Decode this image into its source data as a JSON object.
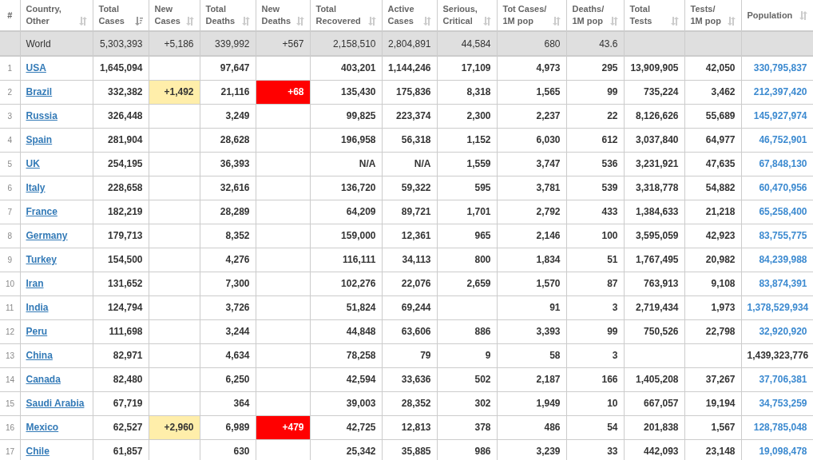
{
  "table": {
    "columns": [
      {
        "lines": [
          "#"
        ]
      },
      {
        "lines": [
          "Country,",
          "Other"
        ],
        "sorted": false
      },
      {
        "lines": [
          "Total",
          "Cases"
        ],
        "sorted": true
      },
      {
        "lines": [
          "New",
          "Cases"
        ],
        "sorted": false
      },
      {
        "lines": [
          "Total",
          "Deaths"
        ],
        "sorted": false
      },
      {
        "lines": [
          "New",
          "Deaths"
        ],
        "sorted": false
      },
      {
        "lines": [
          "Total",
          "Recovered"
        ],
        "sorted": false
      },
      {
        "lines": [
          "Active",
          "Cases"
        ],
        "sorted": false
      },
      {
        "lines": [
          "Serious,",
          "Critical"
        ],
        "sorted": false
      },
      {
        "lines": [
          "Tot Cases/",
          "1M pop"
        ],
        "sorted": false
      },
      {
        "lines": [
          "Deaths/",
          "1M pop"
        ],
        "sorted": false
      },
      {
        "lines": [
          "Total",
          "Tests"
        ],
        "sorted": false
      },
      {
        "lines": [
          "Tests/",
          "1M pop"
        ],
        "sorted": false
      },
      {
        "lines": [
          "Population"
        ],
        "sorted": false
      }
    ],
    "world": {
      "country": "World",
      "total_cases": "5,303,393",
      "new_cases": "+5,186",
      "total_deaths": "339,992",
      "new_deaths": "+567",
      "total_recovered": "2,158,510",
      "active_cases": "2,804,891",
      "serious_critical": "44,584",
      "tot_cases_per_1m": "680",
      "deaths_per_1m": "43.6"
    },
    "rows": [
      {
        "num": "1",
        "country": "USA",
        "total_cases": "1,645,094",
        "total_deaths": "97,647",
        "total_recovered": "403,201",
        "active_cases": "1,144,246",
        "serious_critical": "17,109",
        "tot_cases_per_1m": "4,973",
        "deaths_per_1m": "295",
        "total_tests": "13,909,905",
        "tests_per_1m": "42,050",
        "population": "330,795,837",
        "population_linked": true
      },
      {
        "num": "2",
        "country": "Brazil",
        "total_cases": "332,382",
        "new_cases": "+1,492",
        "total_deaths": "21,116",
        "new_deaths": "+68",
        "total_recovered": "135,430",
        "active_cases": "175,836",
        "serious_critical": "8,318",
        "tot_cases_per_1m": "1,565",
        "deaths_per_1m": "99",
        "total_tests": "735,224",
        "tests_per_1m": "3,462",
        "population": "212,397,420",
        "population_linked": true
      },
      {
        "num": "3",
        "country": "Russia",
        "total_cases": "326,448",
        "total_deaths": "3,249",
        "total_recovered": "99,825",
        "active_cases": "223,374",
        "serious_critical": "2,300",
        "tot_cases_per_1m": "2,237",
        "deaths_per_1m": "22",
        "total_tests": "8,126,626",
        "tests_per_1m": "55,689",
        "population": "145,927,974",
        "population_linked": true
      },
      {
        "num": "4",
        "country": "Spain",
        "total_cases": "281,904",
        "total_deaths": "28,628",
        "total_recovered": "196,958",
        "active_cases": "56,318",
        "serious_critical": "1,152",
        "tot_cases_per_1m": "6,030",
        "deaths_per_1m": "612",
        "total_tests": "3,037,840",
        "tests_per_1m": "64,977",
        "population": "46,752,901",
        "population_linked": true
      },
      {
        "num": "5",
        "country": "UK",
        "total_cases": "254,195",
        "total_deaths": "36,393",
        "total_recovered": "N/A",
        "active_cases": "N/A",
        "serious_critical": "1,559",
        "tot_cases_per_1m": "3,747",
        "deaths_per_1m": "536",
        "total_tests": "3,231,921",
        "tests_per_1m": "47,635",
        "population": "67,848,130",
        "population_linked": true
      },
      {
        "num": "6",
        "country": "Italy",
        "total_cases": "228,658",
        "total_deaths": "32,616",
        "total_recovered": "136,720",
        "active_cases": "59,322",
        "serious_critical": "595",
        "tot_cases_per_1m": "3,781",
        "deaths_per_1m": "539",
        "total_tests": "3,318,778",
        "tests_per_1m": "54,882",
        "population": "60,470,956",
        "population_linked": true
      },
      {
        "num": "7",
        "country": "France",
        "total_cases": "182,219",
        "total_deaths": "28,289",
        "total_recovered": "64,209",
        "active_cases": "89,721",
        "serious_critical": "1,701",
        "tot_cases_per_1m": "2,792",
        "deaths_per_1m": "433",
        "total_tests": "1,384,633",
        "tests_per_1m": "21,218",
        "population": "65,258,400",
        "population_linked": true
      },
      {
        "num": "8",
        "country": "Germany",
        "total_cases": "179,713",
        "total_deaths": "8,352",
        "total_recovered": "159,000",
        "active_cases": "12,361",
        "serious_critical": "965",
        "tot_cases_per_1m": "2,146",
        "deaths_per_1m": "100",
        "total_tests": "3,595,059",
        "tests_per_1m": "42,923",
        "population": "83,755,775",
        "population_linked": true
      },
      {
        "num": "9",
        "country": "Turkey",
        "total_cases": "154,500",
        "total_deaths": "4,276",
        "total_recovered": "116,111",
        "active_cases": "34,113",
        "serious_critical": "800",
        "tot_cases_per_1m": "1,834",
        "deaths_per_1m": "51",
        "total_tests": "1,767,495",
        "tests_per_1m": "20,982",
        "population": "84,239,988",
        "population_linked": true
      },
      {
        "num": "10",
        "country": "Iran",
        "total_cases": "131,652",
        "total_deaths": "7,300",
        "total_recovered": "102,276",
        "active_cases": "22,076",
        "serious_critical": "2,659",
        "tot_cases_per_1m": "1,570",
        "deaths_per_1m": "87",
        "total_tests": "763,913",
        "tests_per_1m": "9,108",
        "population": "83,874,391",
        "population_linked": true
      },
      {
        "num": "11",
        "country": "India",
        "total_cases": "124,794",
        "total_deaths": "3,726",
        "total_recovered": "51,824",
        "active_cases": "69,244",
        "tot_cases_per_1m": "91",
        "deaths_per_1m": "3",
        "total_tests": "2,719,434",
        "tests_per_1m": "1,973",
        "population": "1,378,529,934",
        "population_linked": true
      },
      {
        "num": "12",
        "country": "Peru",
        "total_cases": "111,698",
        "total_deaths": "3,244",
        "total_recovered": "44,848",
        "active_cases": "63,606",
        "serious_critical": "886",
        "tot_cases_per_1m": "3,393",
        "deaths_per_1m": "99",
        "total_tests": "750,526",
        "tests_per_1m": "22,798",
        "population": "32,920,920",
        "population_linked": true
      },
      {
        "num": "13",
        "country": "China",
        "total_cases": "82,971",
        "total_deaths": "4,634",
        "total_recovered": "78,258",
        "active_cases": "79",
        "serious_critical": "9",
        "tot_cases_per_1m": "58",
        "deaths_per_1m": "3",
        "population": "1,439,323,776",
        "population_linked": false
      },
      {
        "num": "14",
        "country": "Canada",
        "total_cases": "82,480",
        "total_deaths": "6,250",
        "total_recovered": "42,594",
        "active_cases": "33,636",
        "serious_critical": "502",
        "tot_cases_per_1m": "2,187",
        "deaths_per_1m": "166",
        "total_tests": "1,405,208",
        "tests_per_1m": "37,267",
        "population": "37,706,381",
        "population_linked": true
      },
      {
        "num": "15",
        "country": "Saudi Arabia",
        "total_cases": "67,719",
        "total_deaths": "364",
        "total_recovered": "39,003",
        "active_cases": "28,352",
        "serious_critical": "302",
        "tot_cases_per_1m": "1,949",
        "deaths_per_1m": "10",
        "total_tests": "667,057",
        "tests_per_1m": "19,194",
        "population": "34,753,259",
        "population_linked": true
      },
      {
        "num": "16",
        "country": "Mexico",
        "total_cases": "62,527",
        "new_cases": "+2,960",
        "total_deaths": "6,989",
        "new_deaths": "+479",
        "total_recovered": "42,725",
        "active_cases": "12,813",
        "serious_critical": "378",
        "tot_cases_per_1m": "486",
        "deaths_per_1m": "54",
        "total_tests": "201,838",
        "tests_per_1m": "1,567",
        "population": "128,785,048",
        "population_linked": true
      },
      {
        "num": "17",
        "country": "Chile",
        "total_cases": "61,857",
        "total_deaths": "630",
        "total_recovered": "25,342",
        "active_cases": "35,885",
        "serious_critical": "986",
        "tot_cases_per_1m": "3,239",
        "deaths_per_1m": "33",
        "total_tests": "442,093",
        "tests_per_1m": "23,148",
        "population": "19,098,478",
        "population_linked": true
      }
    ]
  }
}
